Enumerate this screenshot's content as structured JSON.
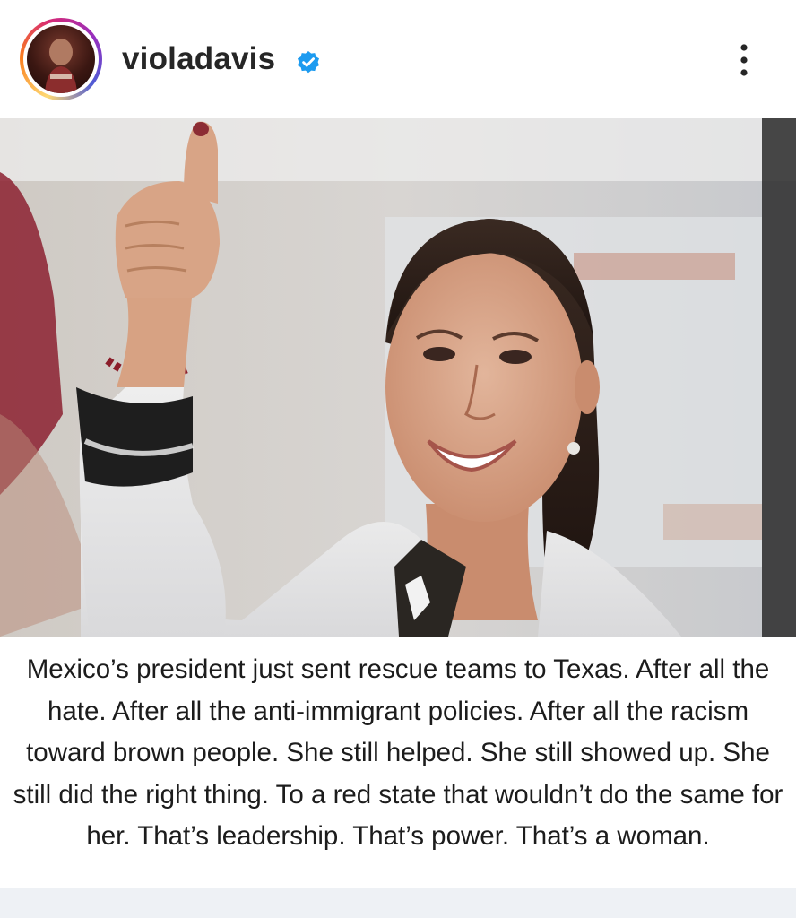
{
  "post": {
    "username": "violadavis",
    "verified": true,
    "caption": "Mexico’s president just sent rescue teams to Texas. After all the hate. After all the anti-immigrant policies. After all the racism toward brown people. She still helped. She still showed up. She still did the right thing. To a red state that wouldn’t do the same for her. That’s leadership. That’s power. That’s a woman."
  },
  "icons": {
    "verified": "verified-badge-icon",
    "more": "more-options-icon"
  },
  "colors": {
    "verified_blue": "#1d9bf0",
    "text": "#262626"
  }
}
